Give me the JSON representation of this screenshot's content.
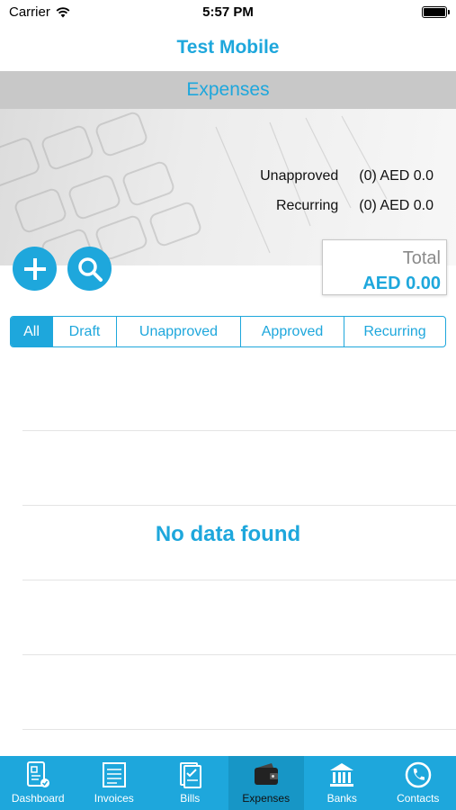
{
  "status_bar": {
    "carrier": "Carrier",
    "time": "5:57 PM"
  },
  "header": {
    "title": "Test Mobile"
  },
  "section": {
    "title": "Expenses"
  },
  "summary": {
    "unapproved_label": "Unapproved",
    "unapproved_value": "(0) AED 0.0",
    "recurring_label": "Recurring",
    "recurring_value": "(0) AED 0.0"
  },
  "total": {
    "label": "Total",
    "value": "AED 0.00"
  },
  "filters": [
    {
      "label": "All",
      "active": true
    },
    {
      "label": "Draft",
      "active": false
    },
    {
      "label": "Unapproved",
      "active": false
    },
    {
      "label": "Approved",
      "active": false
    },
    {
      "label": "Recurring",
      "active": false
    }
  ],
  "empty_message": "No data found",
  "tabbar": {
    "items": [
      {
        "label": "Dashboard",
        "icon": "dashboard-icon"
      },
      {
        "label": "Invoices",
        "icon": "invoice-icon"
      },
      {
        "label": "Bills",
        "icon": "bill-icon"
      },
      {
        "label": "Expenses",
        "icon": "wallet-icon"
      },
      {
        "label": "Banks",
        "icon": "bank-icon"
      },
      {
        "label": "Contacts",
        "icon": "phone-icon"
      }
    ],
    "active_index": 3
  },
  "colors": {
    "accent": "#1ea7dc",
    "section_bar": "#c8c8c8"
  }
}
